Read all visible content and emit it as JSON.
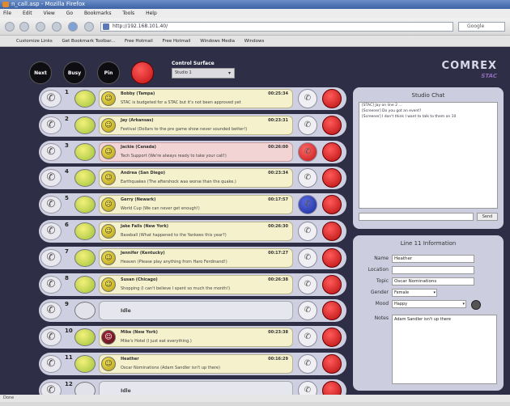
{
  "browser": {
    "title": "n_call.asp - Mozilla Firefox",
    "menu": [
      "File",
      "Edit",
      "View",
      "Go",
      "Bookmarks",
      "Tools",
      "Help"
    ],
    "address": "http://192.168.101.40/",
    "search_placeholder": "Google",
    "bookmarks": [
      "Customize Links",
      "Get Bookmark Toolbar...",
      "Free Hotmail",
      "Free Hotmail",
      "Windows Media",
      "Windows"
    ],
    "status": "Done"
  },
  "header": {
    "next_label": "Next",
    "busy_label": "Busy",
    "pin_label": "Pin",
    "control_label": "Control Surface",
    "control_value": "Studio 1",
    "logo_text": "COMREX",
    "logo_sub": "STAC"
  },
  "lines": [
    {
      "num": "1",
      "name": "Bobby (Tampa)",
      "time": "00:25:34",
      "note": "STAC is budgeted for a STAC but it's not been approved yet",
      "card": "yellow",
      "avatar": "smile",
      "rb1": "normal"
    },
    {
      "num": "2",
      "name": "Jay (Arkansas)",
      "time": "00:23:31",
      "note": "Festival (Dollars to the pre game show never sounded better!)",
      "card": "yellow",
      "avatar": "smile",
      "rb1": "normal"
    },
    {
      "num": "3",
      "name": "Jackie (Canada)",
      "time": "00:26:00",
      "note": "Tech Support (We're always ready to take your call!)",
      "card": "pink",
      "avatar": "smile",
      "rb1": "red"
    },
    {
      "num": "4",
      "name": "Andrea (San Diego)",
      "time": "00:23:34",
      "note": "Earthquakes (The aftershock was worse than the quake.)",
      "card": "yellow",
      "avatar": "smile",
      "rb1": "normal"
    },
    {
      "num": "5",
      "name": "Gerry (Newark)",
      "time": "00:17:57",
      "note": "World Cup (We can never get enough!)",
      "card": "yellow",
      "avatar": "off",
      "rb1": "blue"
    },
    {
      "num": "6",
      "name": "Jake Falls (New York)",
      "time": "00:26:30",
      "note": "Baseball (What happened to the Yankees this year?)",
      "card": "yellow",
      "avatar": "smile",
      "rb1": "normal"
    },
    {
      "num": "7",
      "name": "Jennifer (Kentucky)",
      "time": "00:17:27",
      "note": "Heaven (Please play anything from Haro Ferdinand!)",
      "card": "yellow",
      "avatar": "smile",
      "rb1": "normal"
    },
    {
      "num": "8",
      "name": "Susan (Chicago)",
      "time": "00:26:38",
      "note": "Shopping (I can't believe I spent so much the month!)",
      "card": "yellow",
      "avatar": "smile",
      "rb1": "normal"
    },
    {
      "num": "9",
      "name": "",
      "time": "",
      "note": "Idle",
      "card": "blank",
      "avatar": "blank",
      "rb1": "normal"
    },
    {
      "num": "10",
      "name": "Mike (New York)",
      "time": "00:23:38",
      "note": "Mike's Hotel (I just eat everything.)",
      "card": "yellow",
      "avatar": "dark",
      "rb1": "normal"
    },
    {
      "num": "11",
      "name": "Heather",
      "time": "00:16:29",
      "note": "Oscar Nominations (Adam Sandler isn't up there)",
      "card": "yellow",
      "avatar": "smile",
      "rb1": "normal"
    },
    {
      "num": "12",
      "name": "",
      "time": "",
      "note": "Idle",
      "card": "blank",
      "avatar": "blank",
      "rb1": "normal"
    }
  ],
  "chat": {
    "title": "Studio Chat",
    "messages": [
      "[STAC] Jay on line 2 ...",
      "[Screener] Do you got an event?",
      "[Screener] I don't think I want to talk to them on 10"
    ],
    "send_label": "Send"
  },
  "info": {
    "title": "Line 11 Information",
    "name_label": "Name",
    "name_value": "Heather",
    "location_label": "Location",
    "location_value": "",
    "topic_label": "Topic",
    "topic_value": "Oscar Nominations",
    "gender_label": "Gender",
    "gender_value": "Female",
    "mood_label": "Mood",
    "mood_value": "Happy",
    "notes_label": "Notes",
    "notes_value": "Adam Sandler isn't up there"
  }
}
